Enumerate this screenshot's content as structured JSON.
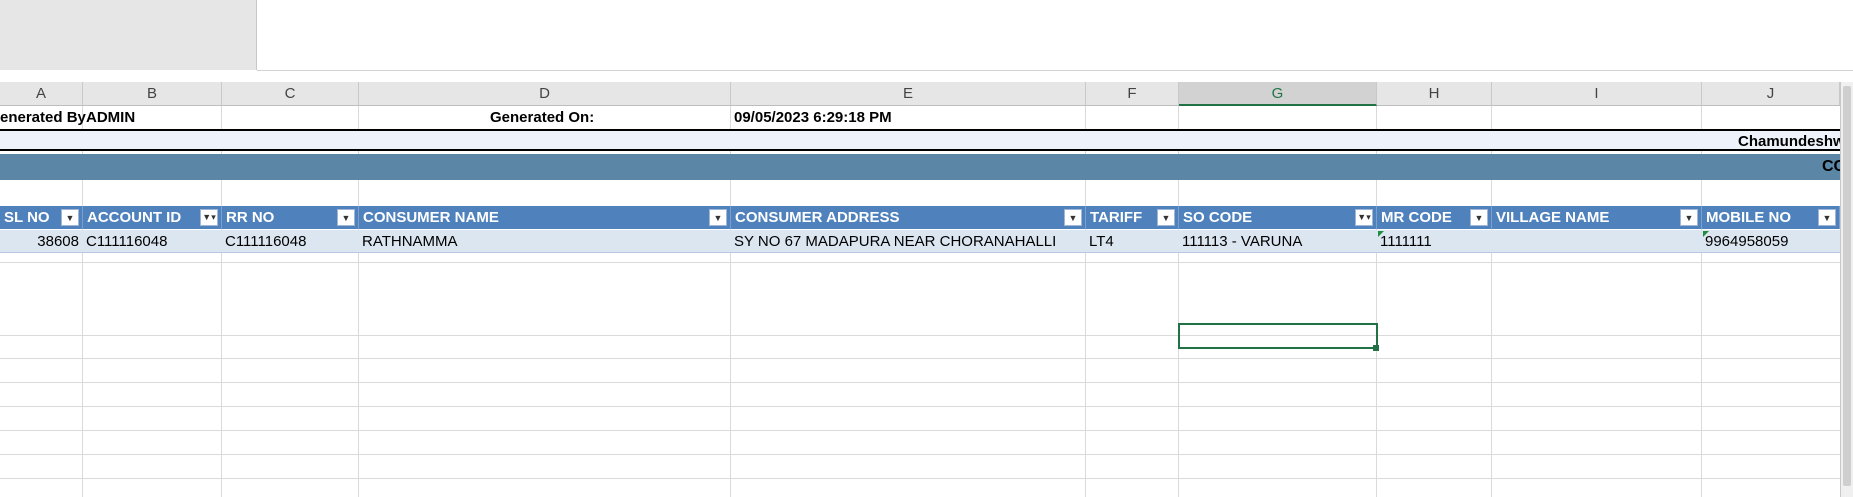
{
  "columns": [
    "A",
    "B",
    "C",
    "D",
    "E",
    "F",
    "G",
    "H",
    "I",
    "J"
  ],
  "selected_column": "G",
  "row1": {
    "generated_by_label": "enerated By",
    "generated_by_value": "ADMIN",
    "generated_on_label": "Generated On:",
    "generated_on_value": "09/05/2023 6:29:18 PM"
  },
  "band_light_text": "Chamundeshw",
  "band_dark_text": "CC",
  "headers": [
    "SL NO",
    "ACCOUNT ID",
    "RR NO",
    "CONSUMER NAME",
    "CONSUMER ADDRESS",
    "TARIFF",
    "SO CODE",
    "MR CODE",
    "VILLAGE NAME",
    "MOBILE NO"
  ],
  "filtered_headers": [
    "ACCOUNT ID",
    "SO CODE"
  ],
  "row": {
    "sl_no": "38608",
    "account_id": "C111116048",
    "rr_no": "C111116048",
    "consumer_name": "RATHNAMMA",
    "consumer_address": "SY NO 67 MADAPURA NEAR CHORANAHALLI",
    "tariff": "LT4",
    "so_code": "111113 - VARUNA",
    "mr_code": "1111111",
    "village_name": "",
    "mobile_no": "9964958059"
  },
  "colors": {
    "header_blue": "#4f81bd",
    "band_dark": "#5b86a6",
    "row_fill": "#dce6f1",
    "selection_green": "#217346"
  }
}
